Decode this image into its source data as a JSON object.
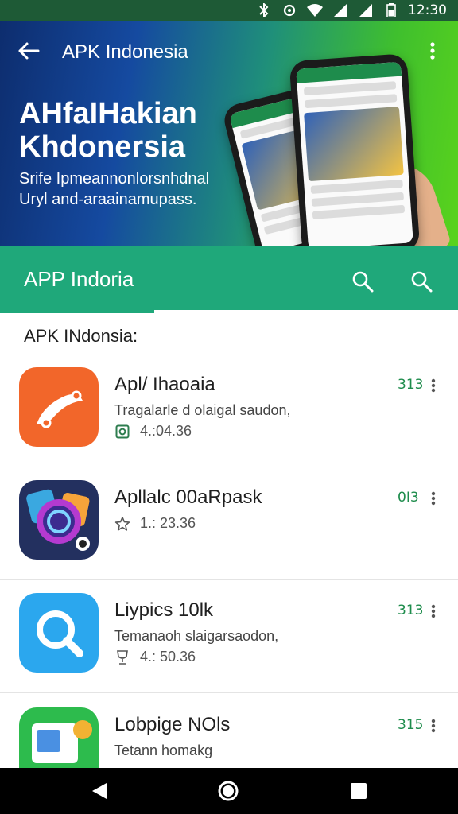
{
  "status_bar": {
    "time": "12:30",
    "icons": [
      "bluetooth-icon",
      "sync-icon",
      "wifi-icon",
      "signal-icon",
      "signal-icon",
      "battery-icon"
    ]
  },
  "hero": {
    "top_title": "APK Indonesia",
    "headline": "AHfaIHakian Khdonersia",
    "tagline": "Srife Ipmeannonlorsnhdnal Uryl and-araainamupass.",
    "back_icon": "back-arrow-icon",
    "more_icon": "more-vert-icon"
  },
  "app_bar": {
    "title": "APP Indoria",
    "icons": [
      "search-icon",
      "search-icon"
    ],
    "accent": "#1fa87a"
  },
  "section": {
    "title": "APK INdonsia:"
  },
  "apps": [
    {
      "name": "Apl/ Ihaoaia",
      "desc": "Tragalarle d olaigal saudon,",
      "meta_icon": "download-icon",
      "meta": "4.:04.36",
      "count": "313",
      "icon_color": "#f2662a"
    },
    {
      "name": "Apllalc 00aRpask",
      "desc": "",
      "meta_icon": "star-outline-icon",
      "meta": "1.: 23.36",
      "count": "0I3",
      "icon_color": "#23305f"
    },
    {
      "name": "Liypics 10lk",
      "desc": "Temanaoh slaigarsaodon,",
      "meta_icon": "trophy-icon",
      "meta": "4.: 50.36",
      "count": "313",
      "icon_color": "#2ba7ee"
    },
    {
      "name": "Lobpige NOls",
      "desc": "Tetann homakg",
      "meta_icon": "",
      "meta": "",
      "count": "315",
      "icon_color": "#2dbb4d"
    }
  ],
  "nav_bar": {
    "buttons": [
      "back-triangle-icon",
      "home-circle-icon",
      "recents-square-icon"
    ]
  }
}
